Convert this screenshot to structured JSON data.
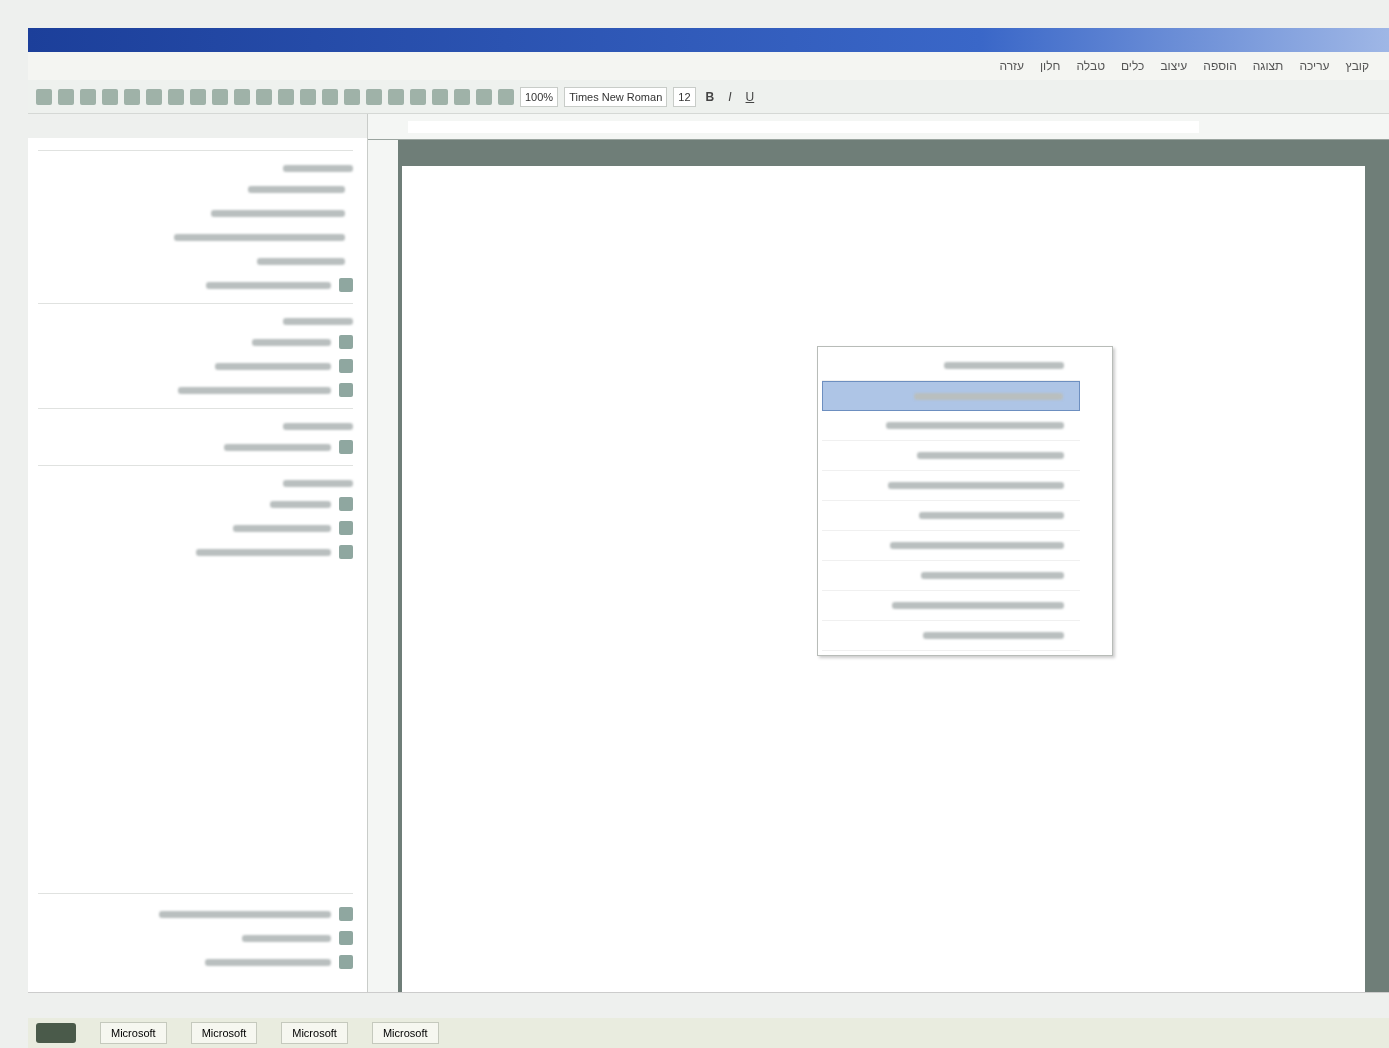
{
  "menu_bar": [
    "קובץ",
    "עריכה",
    "תצוגה",
    "הוספה",
    "עיצוב",
    "כלים",
    "טבלה",
    "חלון",
    "עזרה"
  ],
  "formatting": {
    "zoom": "100%",
    "font": "Times New Roman",
    "size": "12",
    "bold": "B",
    "italic": "I",
    "underline": "U"
  },
  "task_pane": {
    "sections": [
      {
        "items": [
          {
            "has_icon": false
          },
          {
            "has_icon": false
          },
          {
            "has_icon": false
          },
          {
            "has_icon": false
          },
          {
            "has_icon": true
          }
        ]
      },
      {
        "items": [
          {
            "has_icon": true
          },
          {
            "has_icon": true
          },
          {
            "has_icon": true
          }
        ]
      },
      {
        "items": [
          {
            "has_icon": true
          }
        ]
      },
      {
        "items": [
          {
            "has_icon": true
          },
          {
            "has_icon": true
          },
          {
            "has_icon": true
          }
        ]
      }
    ],
    "footer_items": [
      {
        "has_icon": true
      },
      {
        "has_icon": true
      },
      {
        "has_icon": true
      }
    ]
  },
  "dropdown": {
    "items": [
      {
        "selected": false
      },
      {
        "selected": true
      },
      {
        "selected": false
      },
      {
        "selected": false
      },
      {
        "selected": false
      },
      {
        "selected": false
      },
      {
        "selected": false
      },
      {
        "selected": false
      },
      {
        "selected": false
      },
      {
        "selected": false
      }
    ]
  },
  "taskbar": {
    "buttons": [
      "Microsoft",
      "Microsoft",
      "Microsoft",
      "Microsoft"
    ]
  }
}
